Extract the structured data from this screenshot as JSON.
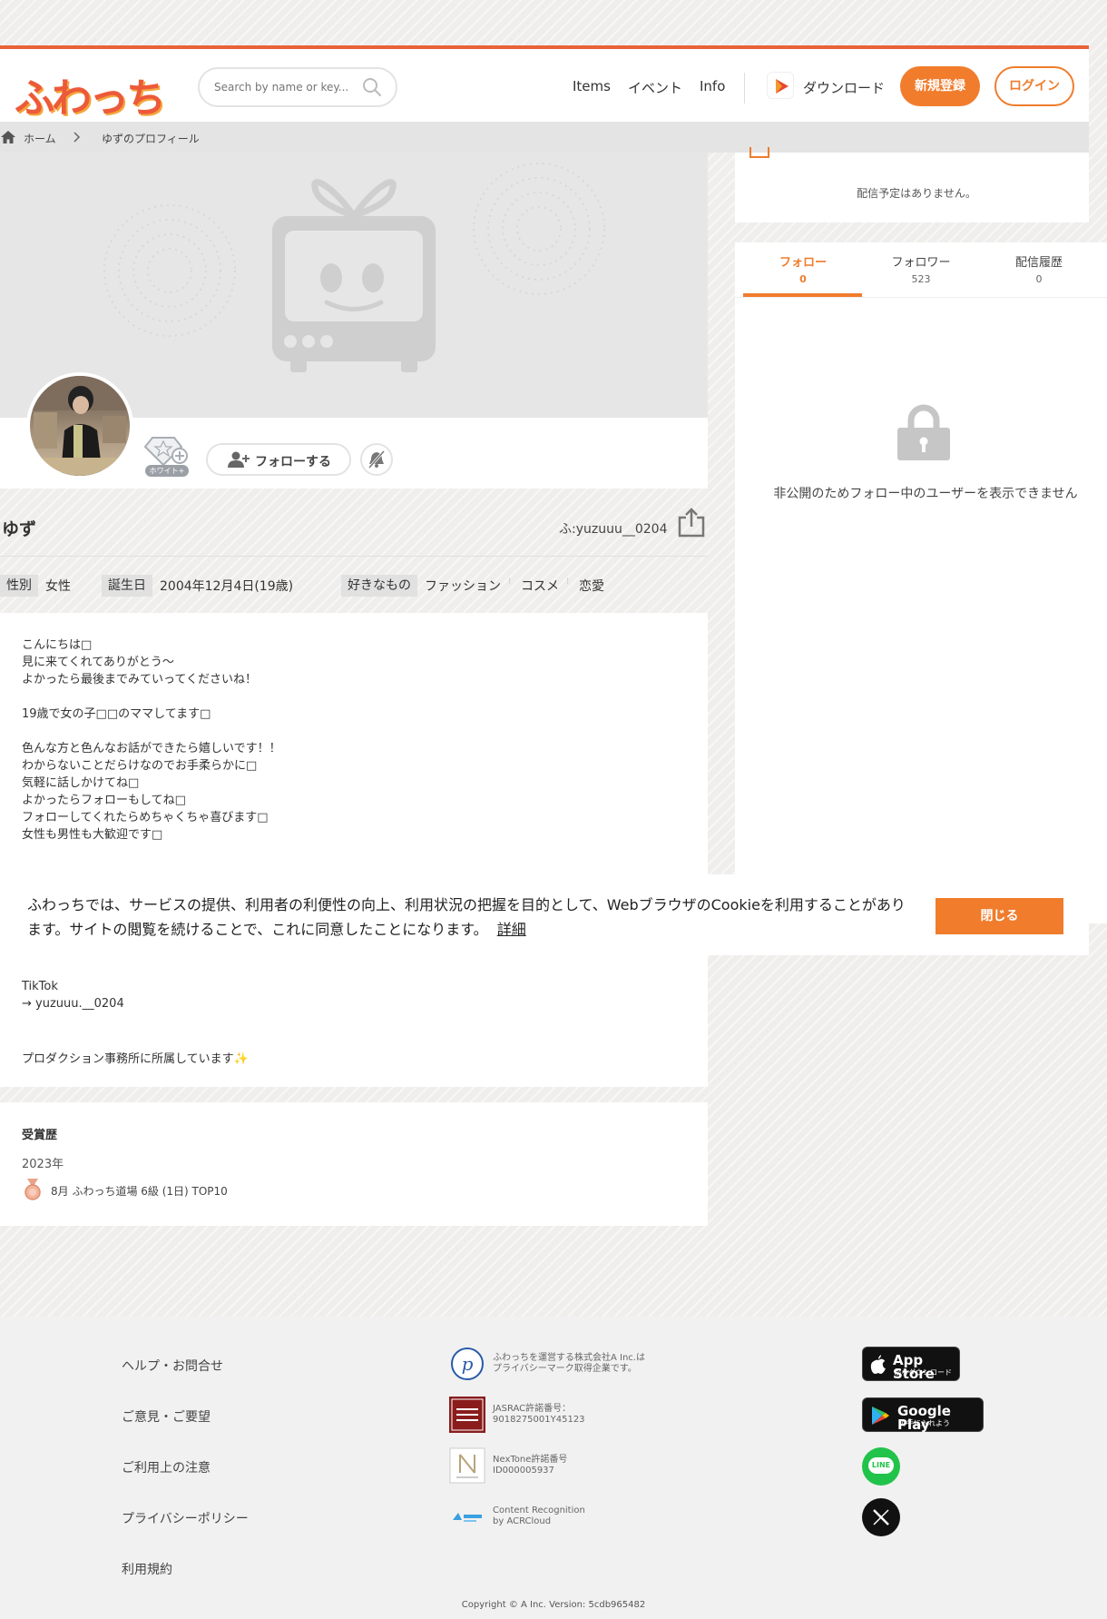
{
  "header": {
    "logo_text": "ふわっち",
    "search_placeholder": "Search by name or key...",
    "nav": {
      "items": "Items",
      "event": "イベント",
      "info": "Info",
      "download": "ダウンロード"
    },
    "register_label": "新規登録",
    "login_label": "ログイン",
    "accent_color": "#f07c2c"
  },
  "breadcrumb": {
    "home": "ホーム",
    "current": "ゆずのプロフィール"
  },
  "schedule": {
    "empty_text": "配信予定はありません。"
  },
  "tabs": [
    {
      "label": "フォロー",
      "count": "0"
    },
    {
      "label": "フォロワー",
      "count": "523"
    },
    {
      "label": "配信履歴",
      "count": "0"
    }
  ],
  "follow_panel": {
    "locked_message": "非公開のためフォロー中のユーザーを表示できません"
  },
  "profile": {
    "badge_label": "ホワイト+",
    "follow_button": "フォローする",
    "name": "ゆず",
    "handle": "ふ:yuzuuu__0204",
    "gender_label": "性別",
    "gender_value": "女性",
    "birthday_label": "誕生日",
    "birthday_value": "2004年12月4日(19歳)",
    "likes_label": "好きなもの",
    "likes": [
      "ファッション",
      "コスメ",
      "恋愛"
    ]
  },
  "bio": {
    "lines_top": [
      "こんにちは□",
      "見に来てくれてありがとう〜",
      "よかったら最後までみていってくださいね！",
      "",
      "19歳で女の子□□のママしてます□",
      "",
      "色んな方と色んなお話ができたら嬉しいです！！",
      "わからないことだらけなのでお手柔らかに□",
      "気軽に話しかけてね□",
      "よかったらフォローもしてね□",
      "フォローしてくれたらめちゃくちゃ喜びます□",
      "女性も男性も大歓迎です□"
    ],
    "lines_bottom": [
      "TikTok",
      "→ yuzuuu.__0204",
      "",
      "",
      "プロダクション事務所に所属しています✨"
    ]
  },
  "cookie": {
    "text": "ふわっちでは、サービスの提供、利用者の利便性の向上、利用状況の把握を目的として、WebブラウザのCookieを利用することがあります。サイトの閲覧を続けることで、これに同意したことになります。",
    "more_label": "詳細",
    "close_label": "閉じる"
  },
  "awards": {
    "title": "受賞歴",
    "year": "2023年",
    "item": "8月 ふわっち道場 6級 (1日) TOP10"
  },
  "footer": {
    "links": [
      "ヘルプ・お問合せ",
      "ご意見・ご要望",
      "ご利用上の注意",
      "プライバシーポリシー",
      "利用規約"
    ],
    "certs": [
      {
        "text": "ふわっちを運営する株式会社A Inc.は\nプライバシーマーク取得企業です。"
      },
      {
        "text": "JASRAC許諾番号：\n9018275001Y45123"
      },
      {
        "text": "NexTone許諾番号\nID000005937"
      },
      {
        "text": "Content Recognition\nby ACRCloud"
      }
    ],
    "app_store": {
      "big": "App Store",
      "small": "からダウンロード"
    },
    "google_play": {
      "big": "Google Play",
      "small": "で手に入れよう"
    },
    "line_label": "LINE",
    "copyright": "Copyright © A Inc. Version: 5cdb965482"
  }
}
